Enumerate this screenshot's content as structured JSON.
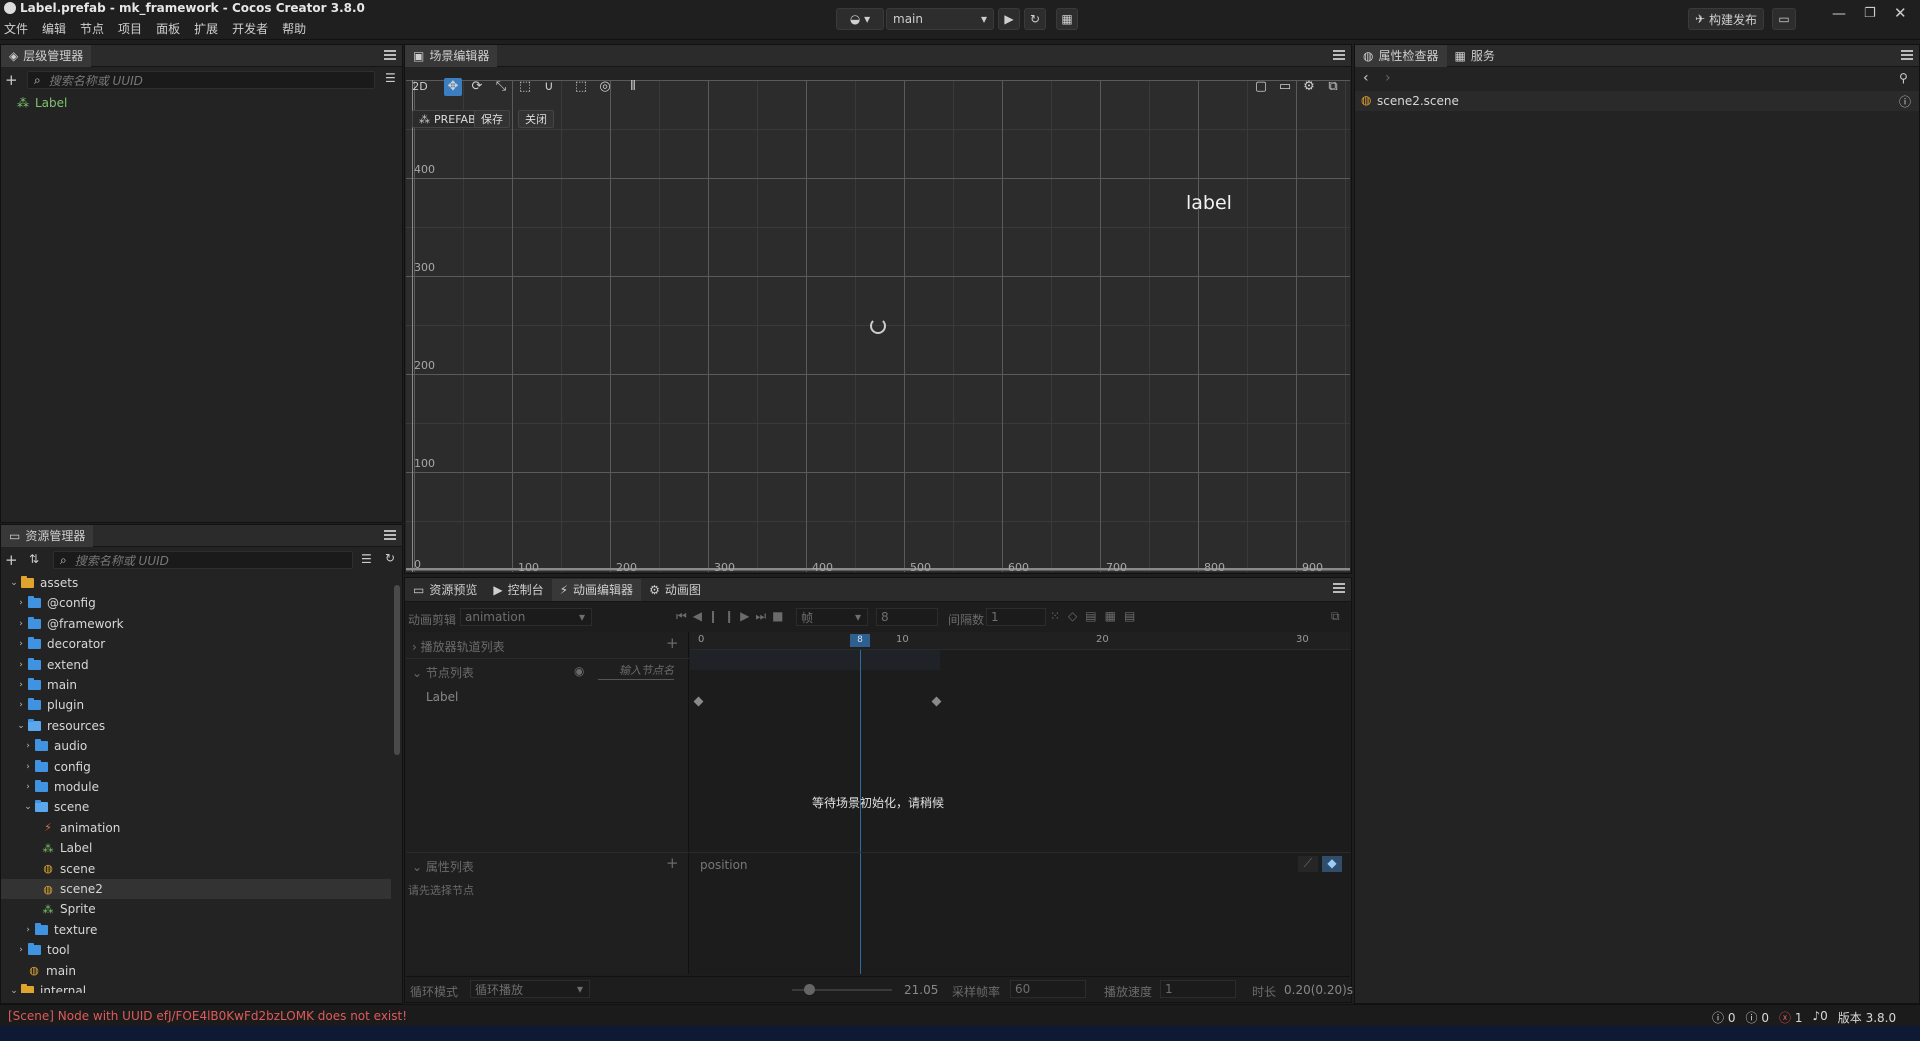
{
  "window": {
    "title": "Label.prefab - mk_framework - Cocos Creator 3.8.0"
  },
  "menus": [
    "文件",
    "编辑",
    "节点",
    "项目",
    "面板",
    "扩展",
    "开发者",
    "帮助"
  ],
  "toolbar": {
    "scene_select": "main",
    "build_label": "构建发布"
  },
  "hierarchy": {
    "tab": "层级管理器",
    "search_placeholder": "搜索名称或 UUID",
    "nodes": [
      "Label"
    ]
  },
  "assets": {
    "tab": "资源管理器",
    "search_placeholder": "搜索名称或 UUID",
    "tree": [
      {
        "label": "assets",
        "depth": 0,
        "arrow": "down",
        "icon": "db"
      },
      {
        "label": "@config",
        "depth": 1,
        "arrow": "right",
        "icon": "folder"
      },
      {
        "label": "@framework",
        "depth": 1,
        "arrow": "right",
        "icon": "folder"
      },
      {
        "label": "decorator",
        "depth": 1,
        "arrow": "right",
        "icon": "folder"
      },
      {
        "label": "extend",
        "depth": 1,
        "arrow": "right",
        "icon": "folder"
      },
      {
        "label": "main",
        "depth": 1,
        "arrow": "right",
        "icon": "folder"
      },
      {
        "label": "plugin",
        "depth": 1,
        "arrow": "right",
        "icon": "folder"
      },
      {
        "label": "resources",
        "depth": 1,
        "arrow": "down",
        "icon": "folder-open"
      },
      {
        "label": "audio",
        "depth": 2,
        "arrow": "right",
        "icon": "folder"
      },
      {
        "label": "config",
        "depth": 2,
        "arrow": "right",
        "icon": "folder"
      },
      {
        "label": "module",
        "depth": 2,
        "arrow": "right",
        "icon": "folder"
      },
      {
        "label": "scene",
        "depth": 2,
        "arrow": "down",
        "icon": "folder-open"
      },
      {
        "label": "animation",
        "depth": 3,
        "arrow": "",
        "icon": "anim"
      },
      {
        "label": "Label",
        "depth": 3,
        "arrow": "",
        "icon": "prefab"
      },
      {
        "label": "scene",
        "depth": 3,
        "arrow": "",
        "icon": "scene"
      },
      {
        "label": "scene2",
        "depth": 3,
        "arrow": "",
        "icon": "scene",
        "selected": true
      },
      {
        "label": "Sprite",
        "depth": 3,
        "arrow": "",
        "icon": "prefab"
      },
      {
        "label": "texture",
        "depth": 2,
        "arrow": "right",
        "icon": "folder"
      },
      {
        "label": "tool",
        "depth": 1,
        "arrow": "right",
        "icon": "folder"
      },
      {
        "label": "main",
        "depth": 1,
        "arrow": "",
        "icon": "scene"
      },
      {
        "label": "internal",
        "depth": 0,
        "arrow": "down",
        "icon": "db"
      }
    ]
  },
  "scene_editor": {
    "tab": "场景编辑器",
    "mode_2d": "2D",
    "prefab_label": "PREFAB",
    "save_label": "保存",
    "close_label": "关闭",
    "label_node_text": "label",
    "y_ticks": [
      "400",
      "300",
      "200",
      "100",
      "0"
    ],
    "x_ticks": [
      "100",
      "200",
      "300",
      "400",
      "500",
      "600",
      "700",
      "800",
      "900"
    ]
  },
  "bottom_tabs": [
    "资源预览",
    "控制台",
    "动画编辑器",
    "动画图"
  ],
  "animation": {
    "clip_label": "动画剪辑",
    "clip_value": "animation",
    "frame_unit": "帧",
    "frame_value": "8",
    "interval_label": "间隔数",
    "interval_value": "1",
    "ruler": [
      "0",
      "10",
      "20",
      "30"
    ],
    "current_frame": "8",
    "player_tracks": "播放器轨道列表",
    "node_list": "节点列表",
    "node_filter_placeholder": "输入节点名",
    "node_name": "Label",
    "waiting_msg": "等待场景初始化，请稍候",
    "prop_list": "属性列表",
    "prop_name": "position",
    "select_node_hint": "请先选择节点",
    "wrap_mode_label": "循环模式",
    "wrap_mode_value": "循环播放",
    "zoom_value": "21.05",
    "sample_label": "采样帧率",
    "sample_value": "60",
    "speed_label": "播放速度",
    "speed_value": "1",
    "duration_label": "时长",
    "duration_value": "0.20(0.20)s"
  },
  "inspector": {
    "tab": "属性检查器",
    "tab2": "服务",
    "asset": "scene2.scene"
  },
  "status": {
    "error": "[Scene] Node with UUID efJ/FOE4lB0KwFd2bzLOMK does not exist!",
    "info_count": "0",
    "warn_count": "0",
    "error_count": "1",
    "notify_count": "0",
    "version": "版本 3.8.0"
  },
  "colors": {
    "accent": "#3c7fc1",
    "error": "#e05a5a",
    "prefab_green": "#7ec46f"
  }
}
